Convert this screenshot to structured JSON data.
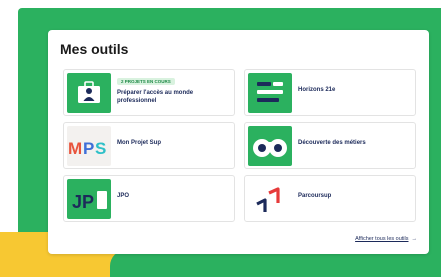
{
  "panel": {
    "title": "Mes outils",
    "tools": [
      {
        "badge": "2 PROJETS EN COURS",
        "label": "Préparer l'accès au monde professionnel",
        "icon": "briefcase-icon"
      },
      {
        "label": "Horizons 21e",
        "icon": "horizons-icon"
      },
      {
        "label": "Mon Projet Sup",
        "icon": "mps-logo"
      },
      {
        "label": "Découverte des métiers",
        "icon": "binoculars-icon"
      },
      {
        "label": "JPO",
        "icon": "jpo-logo"
      },
      {
        "label": "Parcoursup",
        "icon": "parcoursup-logo"
      }
    ],
    "show_all": "Afficher tous les outils",
    "show_all_arrow": "→"
  },
  "colors": {
    "brand_green": "#2bb15f",
    "accent_yellow": "#f7c832",
    "navy": "#1c2a5a"
  }
}
